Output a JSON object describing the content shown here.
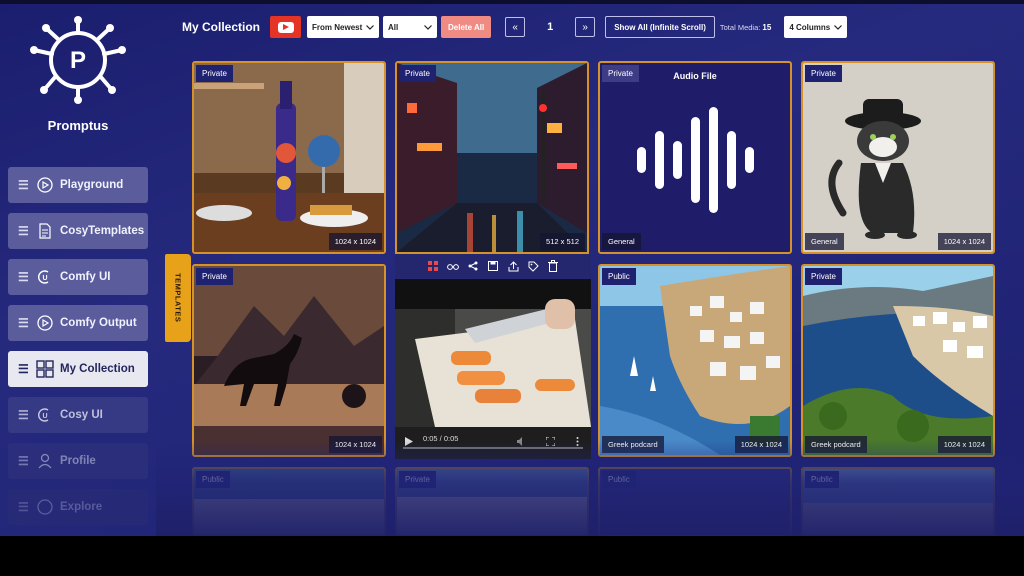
{
  "app": {
    "brand": "Promptus"
  },
  "sidebar": {
    "items": [
      {
        "label": "Playground",
        "icon": "play-circle-icon",
        "state": "normal"
      },
      {
        "label": "CosyTemplates",
        "icon": "document-icon",
        "state": "normal"
      },
      {
        "label": "Comfy UI",
        "icon": "comfy-icon",
        "state": "normal"
      },
      {
        "label": "Comfy Output",
        "icon": "play-circle-icon",
        "state": "normal"
      },
      {
        "label": "My Collection",
        "icon": "grid-icon",
        "state": "active"
      },
      {
        "label": "Cosy UI",
        "icon": "comfy-icon",
        "state": "dim"
      },
      {
        "label": "Profile",
        "icon": "person-icon",
        "state": "dim"
      },
      {
        "label": "Explore",
        "icon": "compass-icon",
        "state": "dim"
      }
    ],
    "templates_tab": "TEMPLATES"
  },
  "toolbar": {
    "title": "My Collection",
    "sort_value": "From Newest",
    "filter_value": "All",
    "delete_label": "Delete All",
    "prev_icon": "«",
    "page": "1",
    "next_icon": "»",
    "show_all_label": "Show All (Infinite Scroll)",
    "total_label": "Total Media:",
    "total_count": "15",
    "columns_value": "4 Columns"
  },
  "colors": {
    "accent": "#d6922a",
    "delete": "#f08b84",
    "youtube": "#e53425"
  },
  "cards": [
    {
      "visibility": "Private",
      "size": "1024 x 1024",
      "category": ""
    },
    {
      "visibility": "Private",
      "size": "512 x 512",
      "category": ""
    },
    {
      "visibility": "Private",
      "title": "Audio File",
      "category": "General",
      "size": ""
    },
    {
      "visibility": "Private",
      "size": "1024 x 1024",
      "category": "General"
    },
    {
      "visibility": "Private",
      "size": "1024 x 1024",
      "category": ""
    },
    {
      "video_time": "0:05 / 0:05"
    },
    {
      "visibility": "Public",
      "size": "1024 x 1024",
      "category": "Greek podcard"
    },
    {
      "visibility": "Private",
      "size": "1024 x 1024",
      "category": "Greek podcard"
    },
    {
      "visibility": "Public"
    },
    {
      "visibility": "Private"
    },
    {
      "visibility": "Public"
    },
    {
      "visibility": "Public"
    }
  ]
}
